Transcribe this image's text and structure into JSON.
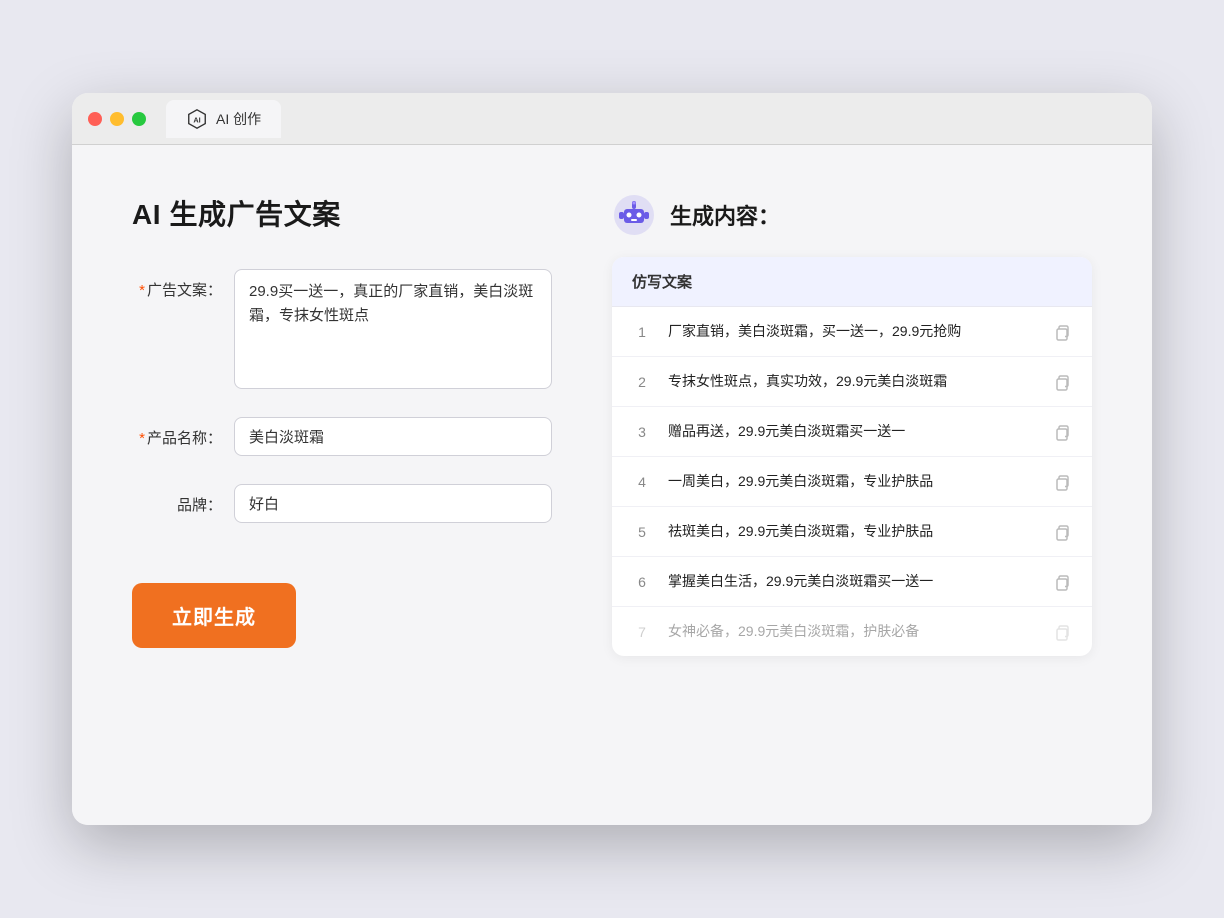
{
  "browser": {
    "tab_label": "AI 创作"
  },
  "page": {
    "title": "AI 生成广告文案",
    "result_title": "生成内容："
  },
  "form": {
    "ad_copy_label": "广告文案：",
    "ad_copy_required": "*",
    "ad_copy_value": "29.9买一送一，真正的厂家直销，美白淡斑霜，专抹女性斑点",
    "product_name_label": "产品名称：",
    "product_name_required": "*",
    "product_name_value": "美白淡斑霜",
    "brand_label": "品牌：",
    "brand_value": "好白",
    "generate_button": "立即生成"
  },
  "results": {
    "table_header": "仿写文案",
    "rows": [
      {
        "id": 1,
        "text": "厂家直销，美白淡斑霜，买一送一，29.9元抢购",
        "faded": false
      },
      {
        "id": 2,
        "text": "专抹女性斑点，真实功效，29.9元美白淡斑霜",
        "faded": false
      },
      {
        "id": 3,
        "text": "赠品再送，29.9元美白淡斑霜买一送一",
        "faded": false
      },
      {
        "id": 4,
        "text": "一周美白，29.9元美白淡斑霜，专业护肤品",
        "faded": false
      },
      {
        "id": 5,
        "text": "祛斑美白，29.9元美白淡斑霜，专业护肤品",
        "faded": false
      },
      {
        "id": 6,
        "text": "掌握美白生活，29.9元美白淡斑霜买一送一",
        "faded": false
      },
      {
        "id": 7,
        "text": "女神必备，29.9元美白淡斑霜，护肤必备",
        "faded": true
      }
    ]
  },
  "colors": {
    "accent": "#f07020",
    "primary": "#5b8af0",
    "required": "#ff4d00"
  }
}
